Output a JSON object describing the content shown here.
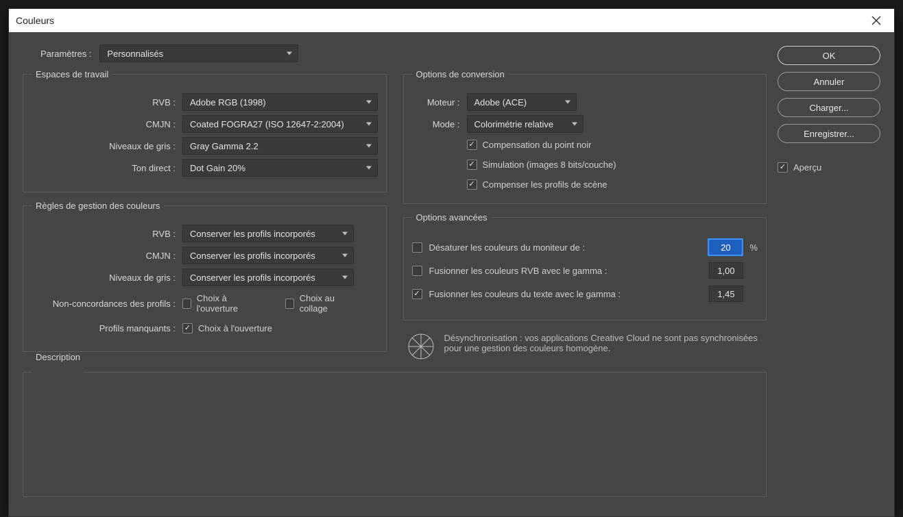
{
  "dialog": {
    "title": "Couleurs"
  },
  "params": {
    "label": "Paramètres :",
    "value": "Personnalisés"
  },
  "workspaces": {
    "legend": "Espaces de travail",
    "rgb_label": "RVB :",
    "rgb_value": "Adobe RGB (1998)",
    "cmyk_label": "CMJN :",
    "cmyk_value": "Coated FOGRA27 (ISO 12647-2:2004)",
    "gray_label": "Niveaux de gris :",
    "gray_value": "Gray Gamma 2.2",
    "spot_label": "Ton direct :",
    "spot_value": "Dot Gain 20%"
  },
  "rules": {
    "legend": "Règles de gestion des couleurs",
    "rgb_label": "RVB :",
    "rgb_value": "Conserver les profils incorporés",
    "cmyk_label": "CMJN :",
    "cmyk_value": "Conserver les profils incorporés",
    "gray_label": "Niveaux de gris :",
    "gray_value": "Conserver les profils incorporés",
    "mismatch_label": "Non-concordances des profils :",
    "mismatch_open": "Choix à l'ouverture",
    "mismatch_paste": "Choix au collage",
    "missing_label": "Profils manquants :",
    "missing_open": "Choix à l'ouverture"
  },
  "conversion": {
    "legend": "Options de conversion",
    "engine_label": "Moteur :",
    "engine_value": "Adobe (ACE)",
    "intent_label": "Mode :",
    "intent_value": "Colorimétrie relative",
    "blackpoint": "Compensation du point noir",
    "dither": "Simulation (images 8 bits/couche)",
    "scene": "Compenser les profils de scène"
  },
  "advanced": {
    "legend": "Options avancées",
    "desat_label": "Désaturer les couleurs du moniteur de :",
    "desat_value": "20",
    "desat_unit": "%",
    "blend_rgb_label": "Fusionner les couleurs RVB avec le gamma :",
    "blend_rgb_value": "1,00",
    "blend_text_label": "Fusionner les couleurs du texte avec le gamma :",
    "blend_text_value": "1,45"
  },
  "sync": {
    "text": "Désynchronisation : vos applications Creative Cloud ne sont pas synchronisées pour une gestion des couleurs homogène."
  },
  "description": {
    "legend": "Description"
  },
  "buttons": {
    "ok": "OK",
    "cancel": "Annuler",
    "load": "Charger...",
    "save": "Enregistrer...",
    "preview": "Aperçu"
  }
}
